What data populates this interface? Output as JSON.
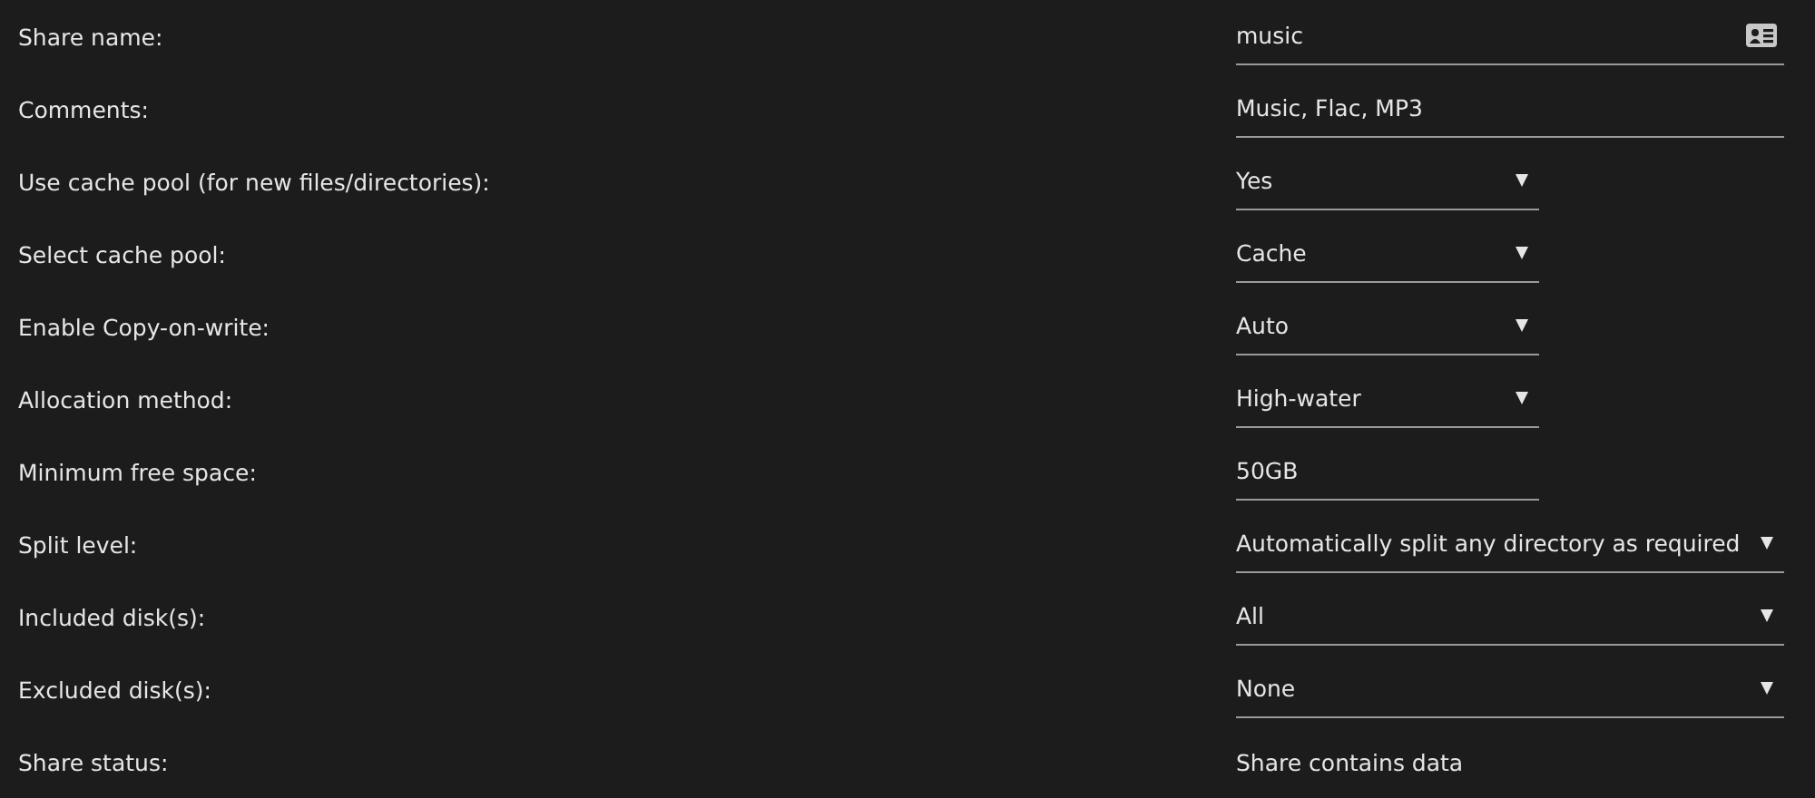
{
  "fields": [
    {
      "label": "Share name:",
      "kind": "name-input",
      "value": "music",
      "wide": true
    },
    {
      "label": "Comments:",
      "kind": "input",
      "value": "Music, Flac, MP3",
      "wide": true
    },
    {
      "label": "Use cache pool (for new files/directories):",
      "kind": "select",
      "value": "Yes",
      "wide": false
    },
    {
      "label": "Select cache pool:",
      "kind": "select",
      "value": "Cache",
      "wide": false
    },
    {
      "label": "Enable Copy-on-write:",
      "kind": "select",
      "value": "Auto",
      "wide": false
    },
    {
      "label": "Allocation method:",
      "kind": "select",
      "value": "High-water",
      "wide": false
    },
    {
      "label": "Minimum free space:",
      "kind": "input",
      "value": "50GB",
      "wide": false
    },
    {
      "label": "Split level:",
      "kind": "select",
      "value": "Automatically split any directory as required",
      "wide": true
    },
    {
      "label": "Included disk(s):",
      "kind": "select",
      "value": "All",
      "wide": true
    },
    {
      "label": "Excluded disk(s):",
      "kind": "select",
      "value": "None",
      "wide": true
    },
    {
      "label": "Share status:",
      "kind": "status",
      "value": "Share contains data"
    }
  ]
}
